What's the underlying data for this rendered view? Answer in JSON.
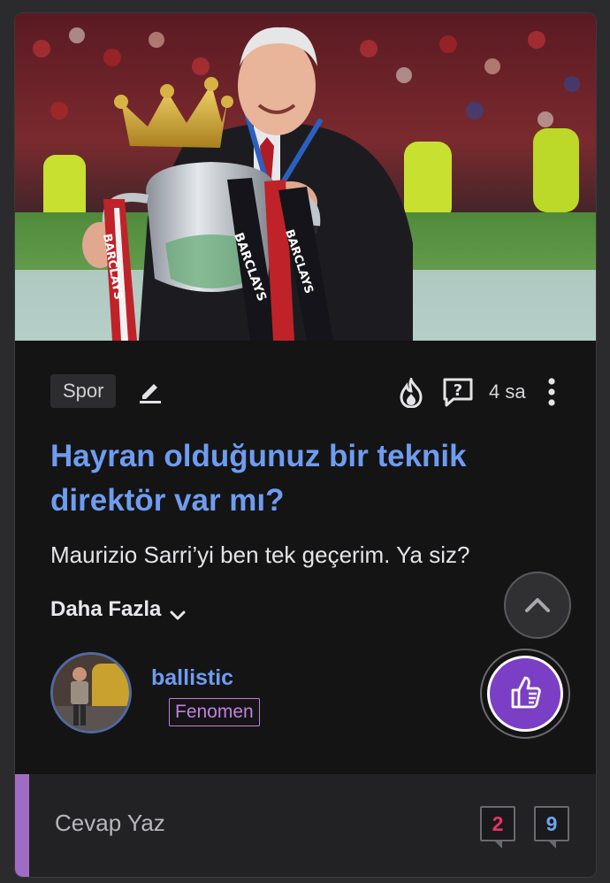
{
  "post": {
    "category": "Spor",
    "time_ago": "4 sa",
    "title": "Hayran olduğunuz bir teknik direktör var mı?",
    "excerpt": "Maurizio Sarri’yi ben tek geçerim. Ya siz?",
    "more_label": "Daha Fazla"
  },
  "icons": {
    "edit": "pencil-icon",
    "trending": "fire-icon",
    "question": "question-bubble-icon",
    "more": "more-vertical-icon",
    "scroll_up": "chevron-up-icon",
    "like": "thumbs-up-icon"
  },
  "author": {
    "username": "ballistic",
    "rank": "Fenomen"
  },
  "reply": {
    "placeholder": "Cevap Yaz",
    "count_red": "2",
    "count_blue": "9"
  },
  "colors": {
    "title": "#6e9cf0",
    "badge": "#c47fe0",
    "like": "#7b3fc6",
    "accent": "#9f6cc4",
    "count_red": "#e8336a",
    "count_blue": "#6ea4ee"
  }
}
